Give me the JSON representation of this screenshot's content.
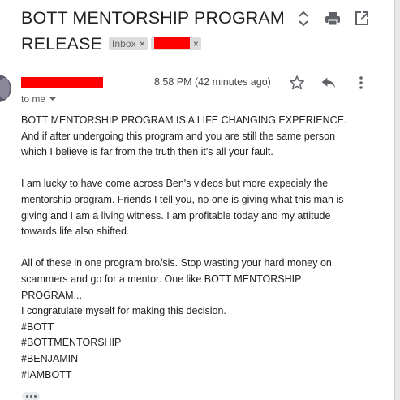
{
  "subject": {
    "line1": "BOTT MENTORSHIP PROGRAM",
    "line2": "RELEASE"
  },
  "labels": [
    {
      "text": "Inbox",
      "close": "×"
    },
    {
      "text": "",
      "close": "×",
      "redacted": true
    }
  ],
  "toolbar": {
    "expand_icon": "unfold-icon",
    "print_icon": "print-icon",
    "popout_icon": "open-in-new-window-icon"
  },
  "message": {
    "sender_redacted": true,
    "timestamp": "8:58 PM (42 minutes ago)",
    "recipient": "to me",
    "actions": {
      "star_icon": "star-icon",
      "reply_icon": "reply-icon",
      "more_icon": "more-vert-icon"
    },
    "paragraphs": [
      [
        "BOTT MENTORSHIP PROGRAM IS A LIFE CHANGING EXPERIENCE.",
        "And if after undergoing this program and you are still the same person",
        "which I believe is far from the truth then it's all your fault."
      ],
      [
        "I am lucky to have come across Ben's videos but more expecialy the",
        "mentorship program. Friends I tell you, no one is giving what this man is",
        "giving and I am a living witness. I am profitable today and my attitude",
        "towards life also shifted."
      ],
      [
        "All of these in one program bro/sis. Stop wasting your hard money on",
        "scammers and go for a mentor. One like BOTT MENTORSHIP",
        "PROGRAM...",
        "I congratulate myself for making this decision.",
        "#BOTT",
        "#BOTTMENTORSHIP",
        "#BENJAMIN",
        "#IAMBOTT"
      ]
    ],
    "trimmed_content_icon": "ellipsis-icon"
  },
  "colors": {
    "redaction": "#ff0000",
    "text": "#222222",
    "muted": "#5f6368"
  }
}
